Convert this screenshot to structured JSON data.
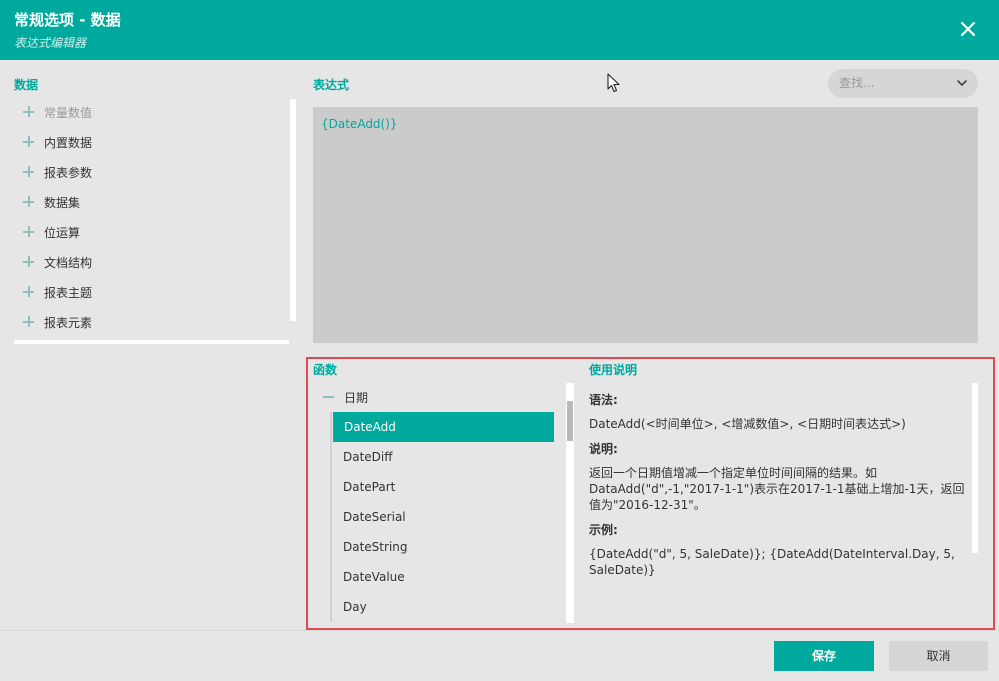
{
  "dialog": {
    "title": "常规选项 - 数据",
    "subtitle": "表达式编辑器"
  },
  "data_panel": {
    "label": "数据",
    "items": [
      {
        "label": "常量数值"
      },
      {
        "label": "内置数据"
      },
      {
        "label": "报表参数"
      },
      {
        "label": "数据集"
      },
      {
        "label": "位运算"
      },
      {
        "label": "文档结构"
      },
      {
        "label": "报表主题"
      },
      {
        "label": "报表元素"
      }
    ]
  },
  "expression": {
    "label": "表达式",
    "value": "{DateAdd()}",
    "search_placeholder": "查找..."
  },
  "functions": {
    "label": "函数",
    "group": "日期",
    "items": [
      "DateAdd",
      "DateDiff",
      "DatePart",
      "DateSerial",
      "DateString",
      "DateValue",
      "Day"
    ],
    "selected": "DateAdd"
  },
  "usage": {
    "label": "使用说明",
    "syntax_heading": "语法:",
    "syntax": "DateAdd(<时间单位>, <增减数值>, <日期时间表达式>)",
    "description_heading": "说明:",
    "description": "返回一个日期值增减一个指定单位时间间隔的结果。如DataAdd(\"d\",-1,\"2017-1-1\")表示在2017-1-1基础上增加-1天，返回值为\"2016-12-31\"。",
    "example_heading": "示例:",
    "example": "{DateAdd(\"d\", 5, SaleDate)}; {DateAdd(DateInterval.Day, 5, SaleDate)}"
  },
  "footer": {
    "save_label": "保存",
    "cancel_label": "取消"
  },
  "colors": {
    "accent": "#00a99d",
    "highlight_frame": "#e0494f"
  }
}
